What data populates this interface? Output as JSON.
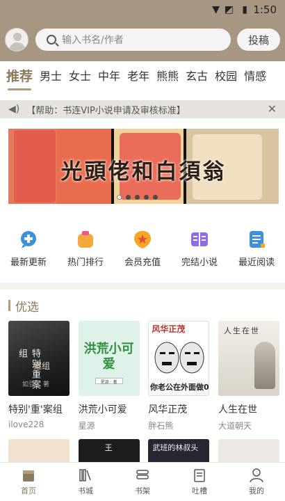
{
  "status_bar": {
    "time": "1:50",
    "wifi_icon": "wifi-icon",
    "signal_icon": "no-signal-icon",
    "battery_icon": "battery-icon"
  },
  "header": {
    "search_placeholder": "输入书名/作者",
    "submit_label": "投稿"
  },
  "tabs": [
    {
      "label": "推荐",
      "active": true
    },
    {
      "label": "男士"
    },
    {
      "label": "女士"
    },
    {
      "label": "中年"
    },
    {
      "label": "老年"
    },
    {
      "label": "熊熊"
    },
    {
      "label": "玄古"
    },
    {
      "label": "校园"
    },
    {
      "label": "情感"
    }
  ],
  "notice": {
    "text": "【帮助：书连VIP小说申请及审核标准】"
  },
  "banner": {
    "title": "光頭佬和白須翁",
    "slide_count": 5,
    "active_slide": 1
  },
  "quick_links": [
    {
      "label": "最新更新",
      "icon": "bubble-plus-icon",
      "color": "#3d8fe0"
    },
    {
      "label": "热门排行",
      "icon": "trophy-icon",
      "color": "#f2a83b"
    },
    {
      "label": "会员充值",
      "icon": "badge-star-icon",
      "color": "#f5a623"
    },
    {
      "label": "完结小说",
      "icon": "open-book-icon",
      "color": "#8f6be8"
    },
    {
      "label": "最近阅读",
      "icon": "document-list-icon",
      "color": "#3d8fe0"
    }
  ],
  "section": {
    "title": "优选"
  },
  "books": [
    {
      "title": "特别'重'案组",
      "author": "ilove228",
      "cover_text": "特别重案组",
      "cover_sub": "案组",
      "cover_author": "如豆尤 著"
    },
    {
      "title": "洪荒小可爱",
      "author": "星源",
      "cover_text": "洪荒小可爱",
      "cover_sub": "星源 · 著"
    },
    {
      "title": "风华正茂",
      "author": "胖石熊",
      "cover_text": "风华正茂",
      "cover_sub": "你老公在外面做0"
    },
    {
      "title": "人生在世",
      "author": "大道朝天",
      "cover_text": "人生在世"
    }
  ],
  "books_row2": [
    {
      "cover_text": ""
    },
    {
      "cover_text": "王"
    },
    {
      "cover_text": "武班的林叔头"
    },
    {
      "cover_text": ""
    }
  ],
  "bottom_nav": [
    {
      "label": "首页",
      "icon": "home-icon",
      "active": true
    },
    {
      "label": "书城",
      "icon": "bookshelf-store-icon"
    },
    {
      "label": "书架",
      "icon": "stacked-books-icon"
    },
    {
      "label": "吐槽",
      "icon": "notebook-icon"
    },
    {
      "label": "我的",
      "icon": "user-icon"
    }
  ],
  "colors": {
    "header_bg": "#a79682",
    "accent": "#8c7a5f",
    "notice_bg": "#e6e3de"
  }
}
